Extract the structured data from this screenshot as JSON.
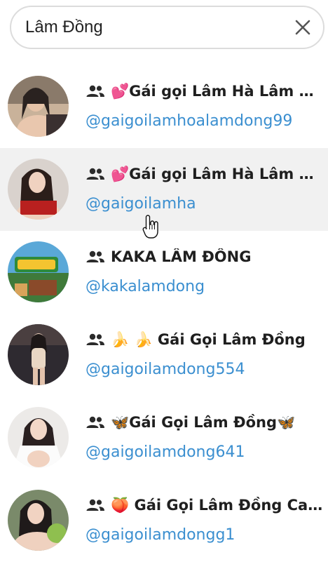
{
  "search": {
    "value": "Lâm Đồng"
  },
  "results": [
    {
      "title": "💕Gái gọi Lâm Hà Lâm Đồng",
      "handle": "@gaigoilamhoalamdong99"
    },
    {
      "title": "💕Gái gọi Lâm Hà Lâm Đồng",
      "handle": "@gaigoilamha"
    },
    {
      "title": "KAKA LÂM ĐỒNG",
      "handle": "@kakalamdong"
    },
    {
      "title": "🍌 🍌 Gái Gọi Lâm Đồng",
      "handle": "@gaigoilamdong554"
    },
    {
      "title": "🦋Gái Gọi Lâm Đồng🦋",
      "handle": "@gaigoilamdong641"
    },
    {
      "title": "🍑 Gái Gọi Lâm Đồng Cao Cấp",
      "handle": "@gaigoilamdongg1"
    }
  ],
  "colors": {
    "handle": "#3b8fd0",
    "hover_row": "#f1f1f1",
    "title": "#1f1f1f"
  },
  "icons": {
    "clear": "close-icon",
    "group": "group-icon",
    "cursor": "hand-cursor-icon"
  }
}
